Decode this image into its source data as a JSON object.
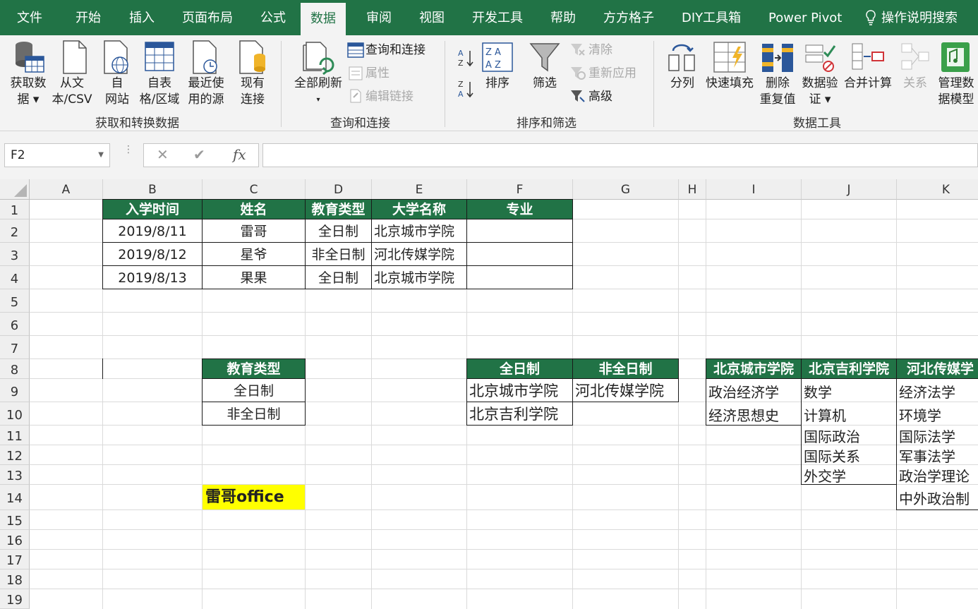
{
  "tabs": [
    "文件",
    "开始",
    "插入",
    "页面布局",
    "公式",
    "数据",
    "审阅",
    "视图",
    "开发工具",
    "帮助",
    "方方格子",
    "DIY工具箱",
    "Power Pivot",
    "操作说明搜索"
  ],
  "active_tab": "数据",
  "ribbon": {
    "get_data": [
      "获取数",
      "据 ▾"
    ],
    "from_csv": [
      "从文",
      "本/CSV"
    ],
    "from_web": [
      "自",
      "网站"
    ],
    "from_table": [
      "自表",
      "格/区域"
    ],
    "recent_sources": [
      "最近使",
      "用的源"
    ],
    "existing_conn": [
      "现有",
      "连接"
    ],
    "group_get": "获取和转换数据",
    "refresh_all": [
      "全部刷新",
      "▾"
    ],
    "queries_conn": "查询和连接",
    "properties": "属性",
    "edit_links": "编辑链接",
    "group_queries": "查询和连接",
    "sort": "排序",
    "filter": "筛选",
    "clear": "清除",
    "reapply": "重新应用",
    "advanced": "高级",
    "group_sort": "排序和筛选",
    "text_to_cols": "分列",
    "flash_fill": "快速填充",
    "remove_dup": [
      "删除",
      "重复值"
    ],
    "data_valid": [
      "数据验",
      "证 ▾"
    ],
    "consolidate": "合并计算",
    "relations": "关系",
    "data_model": [
      "管理数",
      "据模型"
    ],
    "group_tools": "数据工具"
  },
  "formula_bar": {
    "name_box": "F2",
    "cancel": "✕",
    "enter": "✔",
    "fx": "fx",
    "value": ""
  },
  "columns": [
    "A",
    "B",
    "C",
    "D",
    "E",
    "F",
    "G",
    "H",
    "I",
    "J",
    "K"
  ],
  "rows": [
    "1",
    "2",
    "3",
    "4",
    "5",
    "6",
    "7",
    "8",
    "9",
    "10",
    "11",
    "12",
    "13",
    "14",
    "15",
    "16",
    "17",
    "18",
    "19"
  ],
  "main_table": {
    "headers": [
      "入学时间",
      "姓名",
      "教育类型",
      "大学名称",
      "专业"
    ],
    "rows": [
      [
        "2019/8/11",
        "雷哥",
        "全日制",
        "北京城市学院",
        ""
      ],
      [
        "2019/8/12",
        "星爷",
        "非全日制",
        "河北传媒学院",
        ""
      ],
      [
        "2019/8/13",
        "果果",
        "全日制",
        "北京城市学院",
        ""
      ]
    ]
  },
  "edu_list": {
    "header": "教育类型",
    "items": [
      "全日制",
      "非全日制"
    ]
  },
  "school_by_type": {
    "headers": [
      "全日制",
      "非全日制"
    ],
    "full_time": [
      "北京城市学院",
      "北京吉利学院"
    ],
    "part_time": [
      "河北传媒学院"
    ]
  },
  "majors": {
    "headers": [
      "北京城市学院",
      "北京吉利学院",
      "河北传媒学"
    ],
    "beijing_city": [
      "政治经济学",
      "经济思想史"
    ],
    "beijing_geely": [
      "数学",
      "计算机",
      "国际政治",
      "国际关系",
      "外交学"
    ],
    "hebei_media": [
      "经济法学",
      "环境学",
      "国际法学",
      "军事法学",
      "政治学理论",
      "中外政治制"
    ]
  },
  "brand": "雷哥office",
  "colors": {
    "excel_green": "#217346",
    "highlight": "#ffff00"
  }
}
